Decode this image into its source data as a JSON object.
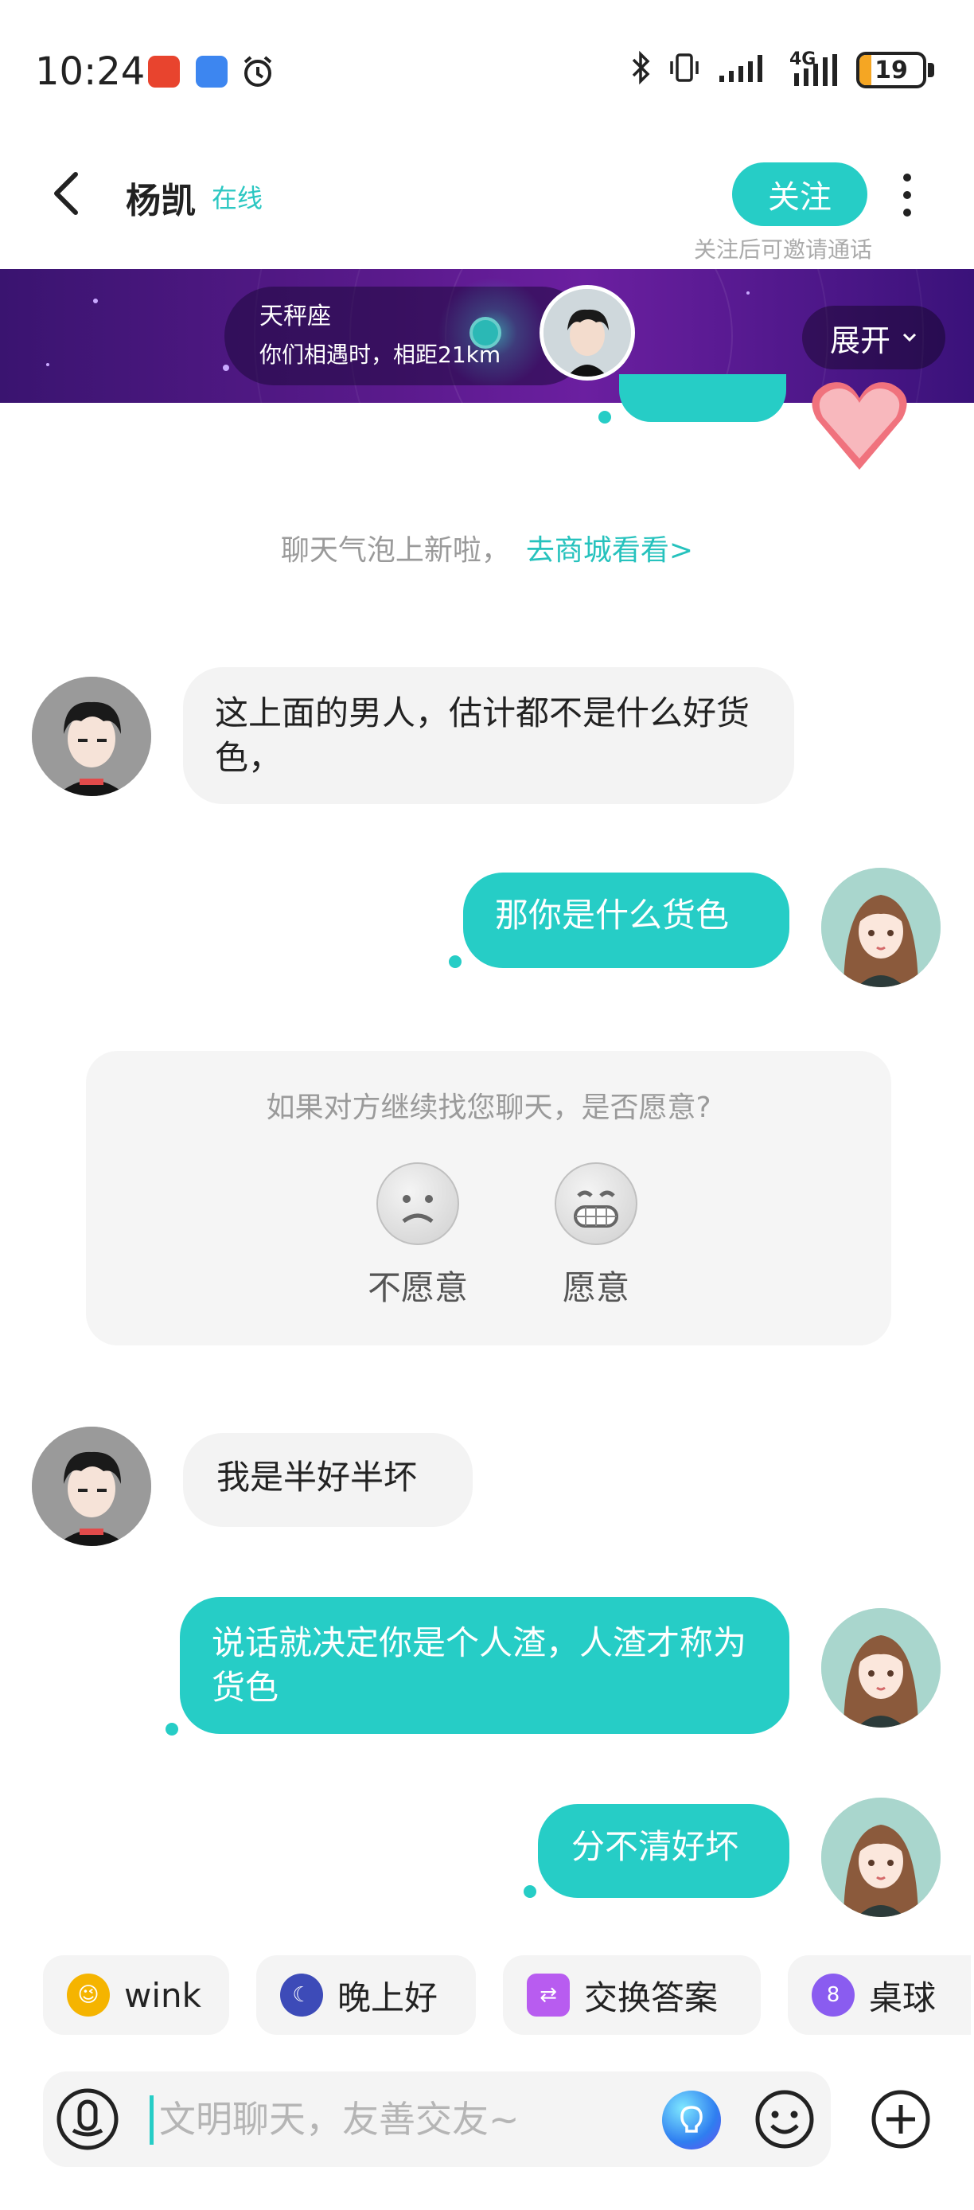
{
  "status_bar": {
    "time": "10:24",
    "battery": "19",
    "battery_level": 0.19,
    "network_label": "4G"
  },
  "header": {
    "name": "杨凯",
    "status": "在线",
    "follow_label": "关注",
    "follow_hint": "关注后可邀请通话"
  },
  "banner": {
    "zodiac": "天秤座",
    "meet_text": "你们相遇时，相距21km",
    "expand_label": "展开"
  },
  "notice": {
    "text": "聊天气泡上新啦，",
    "link": "去商城看看>"
  },
  "messages": [
    {
      "from": "them",
      "text": "这上面的男人，估计都不是什么好货色，"
    },
    {
      "from": "me",
      "text": "那你是什么货色"
    },
    {
      "from": "them",
      "text": "我是半好半坏"
    },
    {
      "from": "me",
      "text": "说话就决定你是个人渣，人渣才称为货色"
    },
    {
      "from": "me",
      "text": "分不清好坏"
    }
  ],
  "willing_card": {
    "question": "如果对方继续找您聊天，是否愿意?",
    "options": [
      "不愿意",
      "愿意"
    ]
  },
  "quick_replies": [
    {
      "label": "wink",
      "icon": "wink-emoji-icon",
      "color": "#f5b400"
    },
    {
      "label": "晚上好",
      "icon": "moon-icon",
      "color": "#3d4bb8"
    },
    {
      "label": "交换答案",
      "icon": "exchange-icon",
      "color": "#b85cf0"
    },
    {
      "label": "桌球",
      "icon": "billiard-ball-icon",
      "color": "#8a5cf0"
    }
  ],
  "input": {
    "placeholder": "文明聊天，友善交友~"
  },
  "colors": {
    "accent": "#26cdc6",
    "incoming_bubble": "#f3f3f3",
    "banner": "#5a1a8c"
  }
}
